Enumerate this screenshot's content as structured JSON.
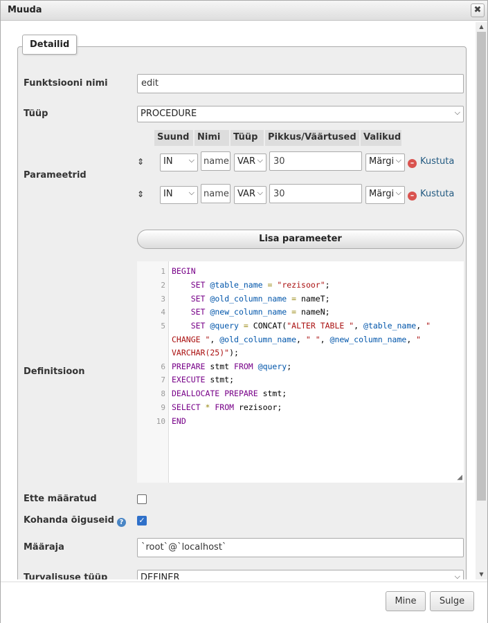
{
  "dialog": {
    "title": "Muuda",
    "close": "✖"
  },
  "tab": {
    "label": "Detailid"
  },
  "form": {
    "name_label": "Funktsiooni nimi",
    "name_value": "edit",
    "type_label": "Tüüp",
    "type_value": "PROCEDURE",
    "params_label": "Parameetrid",
    "params_headers": [
      "Suund",
      "Nimi",
      "Tüüp",
      "Pikkus/Väärtused",
      "Valikud"
    ],
    "params": [
      {
        "direction": "IN",
        "name": "name",
        "type": "VAR",
        "length": "30",
        "options": "Märgi",
        "delete": "Kustuta"
      },
      {
        "direction": "IN",
        "name": "name",
        "type": "VAR",
        "length": "30",
        "options": "Märgi",
        "delete": "Kustuta"
      }
    ],
    "add_param": "Lisa parameeter",
    "definition_label": "Definitsioon",
    "deterministic_label": "Ette määratud",
    "deterministic_checked": false,
    "privileges_label": "Kohanda õiguseid",
    "privileges_checked": true,
    "definer_label": "Määraja",
    "definer_value": "`root`@`localhost`",
    "security_label": "Turvalisuse tüüp",
    "security_value": "DEFINER"
  },
  "code_lines": [
    "1",
    "2",
    "3",
    "4",
    "5",
    "6",
    "7",
    "8",
    "9",
    "10"
  ],
  "footer": {
    "go": "Mine",
    "close": "Sulge"
  },
  "colors": {
    "keyword": "#770088",
    "variable": "#0055aa",
    "string": "#aa1111",
    "link": "#235a81",
    "checkbox": "#2f70c9"
  }
}
